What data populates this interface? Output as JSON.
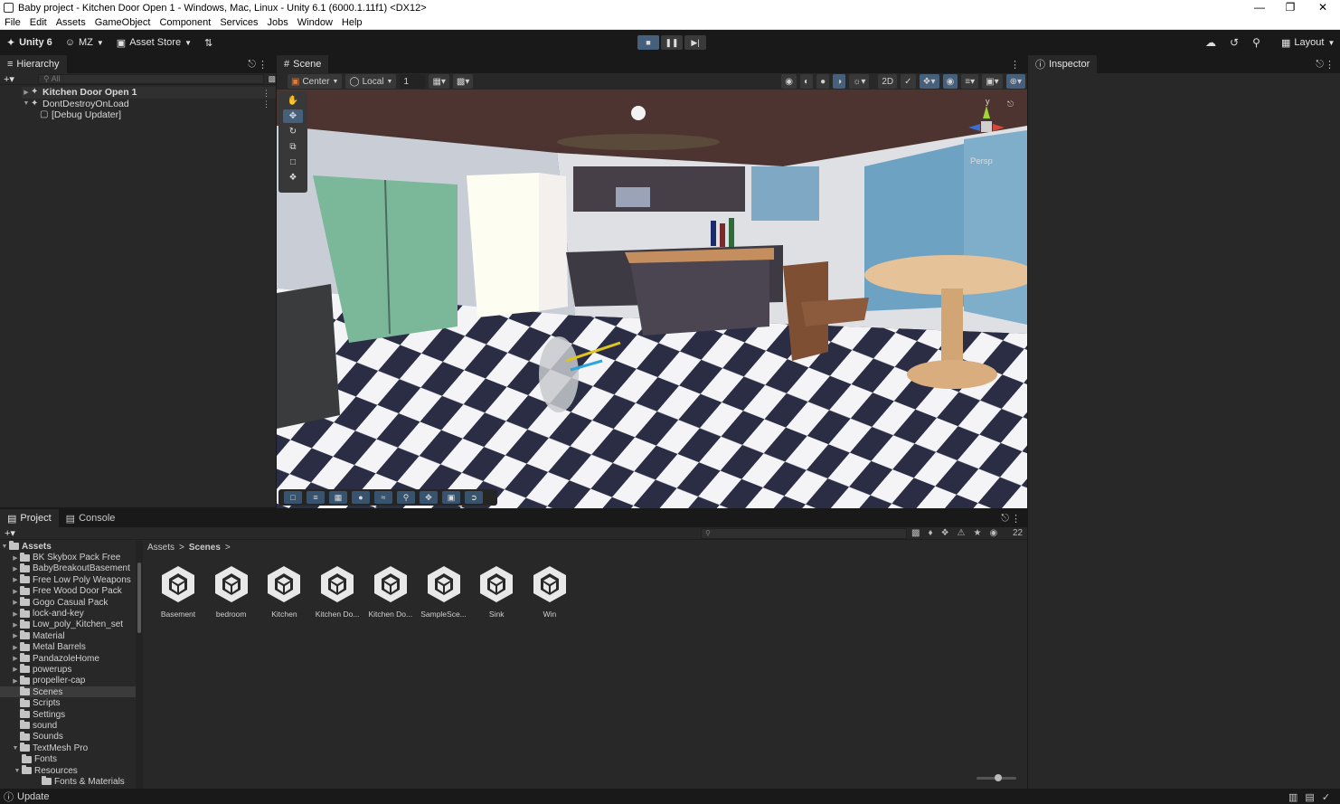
{
  "window": {
    "title": "Baby project - Kitchen Door Open 1 - Windows, Mac, Linux - Unity 6.1 (6000.1.11f1) <DX12>"
  },
  "menu": [
    "File",
    "Edit",
    "Assets",
    "GameObject",
    "Component",
    "Services",
    "Jobs",
    "Window",
    "Help"
  ],
  "toolbar": {
    "unity_label": "Unity 6",
    "account_label": "MZ",
    "asset_store_label": "Asset Store",
    "layout_label": "Layout"
  },
  "hierarchy": {
    "tab": "Hierarchy",
    "search_placeholder": "All",
    "items": [
      {
        "label": "Kitchen Door Open 1"
      },
      {
        "label": "DontDestroyOnLoad"
      },
      {
        "label": "[Debug Updater]"
      }
    ]
  },
  "scene": {
    "tab": "Scene",
    "pivot_label": "Center",
    "space_label": "Local",
    "grid_value": "1",
    "view_2d_label": "2D",
    "persp_label": "Persp",
    "gizmo_y": "y"
  },
  "inspector": {
    "tab": "Inspector"
  },
  "project": {
    "tab": "Project",
    "console_tab": "Console",
    "visible_count": "22",
    "breadcrumb": [
      "Assets",
      "Scenes"
    ],
    "root": "Assets",
    "folders": [
      "BK Skybox Pack Free",
      "BabyBreakoutBasement",
      "Free Low Poly Weapons",
      "Free Wood Door Pack",
      "Gogo Casual Pack",
      "lock-and-key",
      "Low_poly_Kitchen_set",
      "Material",
      "Metal Barrels",
      "PandazoleHome",
      "powerups",
      "propeller-cap",
      "Scenes",
      "Scripts",
      "Settings",
      "sound",
      "Sounds",
      "TextMesh Pro"
    ],
    "sub_fonts": "Fonts",
    "sub_resources": "Resources",
    "sub_fm": "Fonts & Materials",
    "assets": [
      "Basement",
      "bedroom",
      "Kitchen",
      "Kitchen Do...",
      "Kitchen Do...",
      "SampleSce...",
      "Sink",
      "Win"
    ]
  },
  "status": {
    "text": "Update"
  }
}
